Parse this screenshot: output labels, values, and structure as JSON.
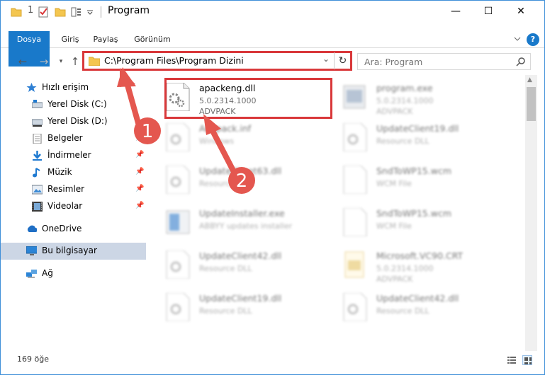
{
  "window": {
    "title": "Program",
    "qa_digit": "1",
    "minimize": "—",
    "maximize": "☐",
    "close": "✕"
  },
  "ribbon": {
    "tabs": [
      "Dosya",
      "Giriş",
      "Paylaş",
      "Görünüm"
    ]
  },
  "nav": {
    "address": "C:\\Program Files\\Program Dizini",
    "search_placeholder": "Ara: Program"
  },
  "sidebar": {
    "items": [
      {
        "label": "Hızlı erişim",
        "icon": "star-icon"
      },
      {
        "label": "Yerel Disk (C:)",
        "icon": "drive-icon"
      },
      {
        "label": "Yerel Disk (D:)",
        "icon": "drive-icon"
      },
      {
        "label": "Belgeler",
        "icon": "documents-icon"
      },
      {
        "label": "İndirmeler",
        "icon": "download-icon"
      },
      {
        "label": "Müzik",
        "icon": "music-icon"
      },
      {
        "label": "Resimler",
        "icon": "pictures-icon"
      },
      {
        "label": "Videolar",
        "icon": "videos-icon"
      },
      {
        "label": "OneDrive",
        "icon": "cloud-icon"
      },
      {
        "label": "Bu bilgisayar",
        "icon": "computer-icon"
      },
      {
        "label": "Ağ",
        "icon": "network-icon"
      }
    ]
  },
  "files": [
    {
      "name": "apackeng.dll",
      "line2": "5.0.2314.1000",
      "line3": "ADVPACK",
      "icon": "dll-icon"
    },
    {
      "name": "program.exe",
      "line2": "5.0.2314.1000",
      "line3": "ADVPACK",
      "icon": "exe-icon"
    },
    {
      "name": "Advpack.inf",
      "line2": "Windows",
      "line3": "",
      "icon": "dll-icon"
    },
    {
      "name": "UpdateClient19.dll",
      "line2": "Resource DLL",
      "line3": "",
      "icon": "dll-icon"
    },
    {
      "name": "UpdateClient63.dll",
      "line2": "Resource DLL",
      "line3": "",
      "icon": "dll-icon"
    },
    {
      "name": "SndToWP15.wcm",
      "line2": "WCM File",
      "line3": "",
      "icon": "file-icon"
    },
    {
      "name": "UpdateInstaller.exe",
      "line2": "ABBYY updates installer",
      "line3": "",
      "icon": "exe-icon"
    },
    {
      "name": "SndToWP15.wcm",
      "line2": "WCM File",
      "line3": "",
      "icon": "file-icon"
    },
    {
      "name": "UpdateClient42.dll",
      "line2": "Resource DLL",
      "line3": "",
      "icon": "dll-icon"
    },
    {
      "name": "Microsoft.VC90.CRT",
      "line2": "5.0.2314.1000",
      "line3": "ADVPACK",
      "icon": "folder-icon"
    },
    {
      "name": "UpdateClient19.dll",
      "line2": "Resource DLL",
      "line3": "",
      "icon": "dll-icon"
    },
    {
      "name": "UpdateClient42.dll",
      "line2": "Resource DLL",
      "line3": "",
      "icon": "dll-icon"
    }
  ],
  "annotations": {
    "step1": "1",
    "step2": "2"
  },
  "status": {
    "count": "169 öğe"
  },
  "colors": {
    "accent": "#1979ca",
    "highlight": "#d9383a",
    "arrow": "#e4574f"
  }
}
